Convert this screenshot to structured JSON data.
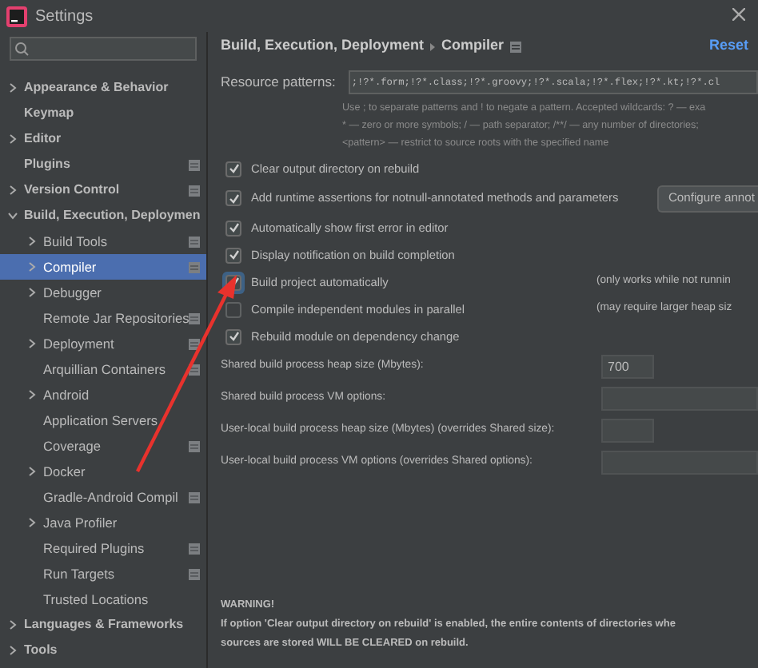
{
  "window": {
    "title": "Settings"
  },
  "sidebar": {
    "items": [
      {
        "label": "Appearance & Behavior",
        "expandable": true,
        "expanded": false,
        "selected": false,
        "project_marker": false
      },
      {
        "label": "Keymap",
        "expandable": false,
        "selected": false,
        "project_marker": false
      },
      {
        "label": "Editor",
        "expandable": true,
        "expanded": false,
        "selected": false,
        "project_marker": false
      },
      {
        "label": "Plugins",
        "expandable": false,
        "selected": false,
        "project_marker": true
      },
      {
        "label": "Version Control",
        "expandable": true,
        "expanded": false,
        "selected": false,
        "project_marker": true
      },
      {
        "label": "Build, Execution, Deploymen",
        "expandable": true,
        "expanded": true,
        "selected": false,
        "project_marker": false,
        "children": [
          {
            "label": "Build Tools",
            "expandable": true,
            "expanded": false,
            "selected": false,
            "project_marker": true
          },
          {
            "label": "Compiler",
            "expandable": true,
            "expanded": false,
            "selected": true,
            "project_marker": true
          },
          {
            "label": "Debugger",
            "expandable": true,
            "expanded": false,
            "selected": false,
            "project_marker": false
          },
          {
            "label": "Remote Jar Repositories",
            "expandable": false,
            "selected": false,
            "project_marker": true
          },
          {
            "label": "Deployment",
            "expandable": true,
            "expanded": false,
            "selected": false,
            "project_marker": true
          },
          {
            "label": "Arquillian Containers",
            "expandable": false,
            "selected": false,
            "project_marker": true
          },
          {
            "label": "Android",
            "expandable": true,
            "expanded": false,
            "selected": false,
            "project_marker": false
          },
          {
            "label": "Application Servers",
            "expandable": false,
            "selected": false,
            "project_marker": false
          },
          {
            "label": "Coverage",
            "expandable": false,
            "selected": false,
            "project_marker": true
          },
          {
            "label": "Docker",
            "expandable": true,
            "expanded": false,
            "selected": false,
            "project_marker": false
          },
          {
            "label": "Gradle-Android Compil",
            "expandable": false,
            "selected": false,
            "project_marker": true
          },
          {
            "label": "Java Profiler",
            "expandable": true,
            "expanded": false,
            "selected": false,
            "project_marker": false
          },
          {
            "label": "Required Plugins",
            "expandable": false,
            "selected": false,
            "project_marker": true
          },
          {
            "label": "Run Targets",
            "expandable": false,
            "selected": false,
            "project_marker": true
          },
          {
            "label": "Trusted Locations",
            "expandable": false,
            "selected": false,
            "project_marker": false
          }
        ]
      },
      {
        "label": "Languages & Frameworks",
        "expandable": true,
        "expanded": false,
        "selected": false,
        "project_marker": false
      },
      {
        "label": "Tools",
        "expandable": true,
        "expanded": false,
        "selected": false,
        "project_marker": false
      }
    ]
  },
  "panel": {
    "breadcrumb": [
      "Build, Execution, Deployment",
      "Compiler"
    ],
    "reset": "Reset",
    "resource_patterns": {
      "label": "Resource patterns:",
      "value": ";!?*.form;!?*.class;!?*.groovy;!?*.scala;!?*.flex;!?*.kt;!?*.cl",
      "hint": [
        "Use ; to separate patterns and ! to negate a pattern. Accepted wildcards: ? — exa",
        "* — zero or more symbols; / — path separator; /**/ — any number of directories;",
        "<pattern> — restrict to source roots with the specified name"
      ]
    },
    "options": [
      {
        "label": "Clear output directory on rebuild",
        "checked": true,
        "focused": false
      },
      {
        "label": "Add runtime assertions for notnull-annotated methods and parameters",
        "checked": true,
        "focused": false,
        "button": "Configure annot"
      },
      {
        "label": "Automatically show first error in editor",
        "checked": true,
        "focused": false
      },
      {
        "label": "Display notification on build completion",
        "checked": true,
        "focused": false
      },
      {
        "label": "Build project automatically",
        "checked": true,
        "focused": true,
        "note": "(only works while not runnin"
      },
      {
        "label": "Compile independent modules in parallel",
        "checked": false,
        "focused": false,
        "note": "(may require larger heap siz"
      },
      {
        "label": "Rebuild module on dependency change",
        "checked": true,
        "focused": false
      }
    ],
    "fields": [
      {
        "label": "Shared build process heap size (Mbytes):",
        "value": "700",
        "kind": "short"
      },
      {
        "label": "Shared build process VM options:",
        "kind": "wide"
      },
      {
        "label": "User-local build process heap size (Mbytes) (overrides Shared size):",
        "kind": "short"
      },
      {
        "label": "User-local build process VM options (overrides Shared options):",
        "kind": "wide"
      }
    ],
    "warning": {
      "title": "WARNING!",
      "lines": [
        "If option 'Clear output directory on rebuild' is enabled, the entire contents of directories whe",
        "sources are stored WILL BE CLEARED on rebuild."
      ]
    }
  }
}
